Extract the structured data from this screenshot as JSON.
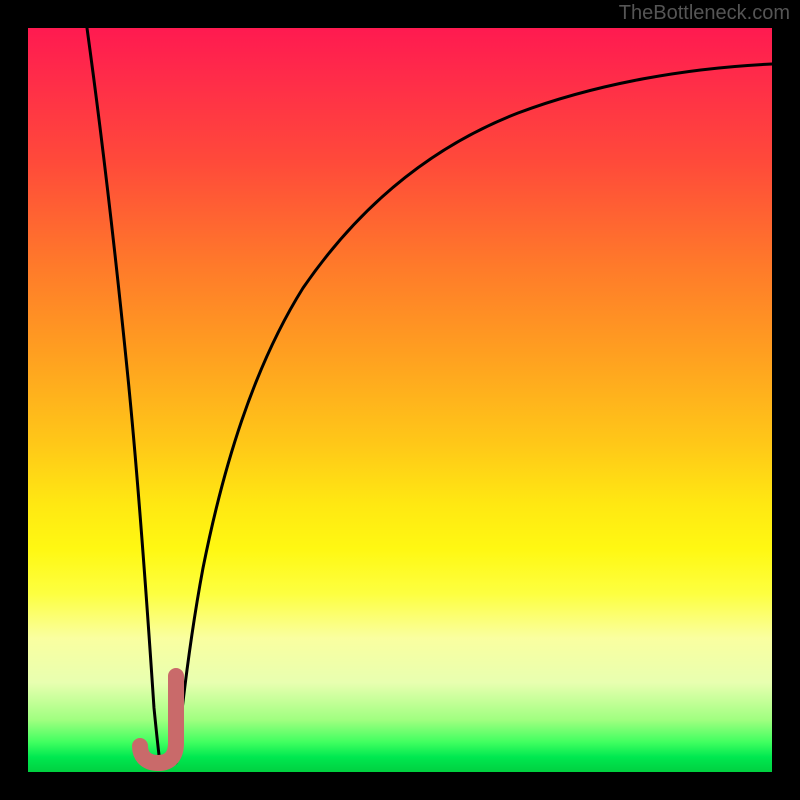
{
  "watermark": "TheBottleneck.com",
  "chart_data": {
    "type": "line",
    "title": "",
    "xlabel": "",
    "ylabel": "",
    "xlim": [
      0,
      100
    ],
    "ylim": [
      0,
      100
    ],
    "series": [
      {
        "name": "left-curve",
        "x": [
          8,
          10,
          12,
          14,
          16,
          17
        ],
        "y": [
          100,
          78,
          55,
          30,
          10,
          2
        ]
      },
      {
        "name": "right-curve",
        "x": [
          19,
          21,
          23,
          26,
          30,
          35,
          42,
          50,
          60,
          72,
          85,
          100
        ],
        "y": [
          2,
          15,
          30,
          45,
          58,
          68,
          76,
          82,
          86,
          89,
          91,
          92
        ]
      }
    ],
    "marker": {
      "name": "j-marker",
      "color": "#cc6666",
      "x_range": [
        14.5,
        20.5
      ],
      "y_range": [
        2,
        12
      ]
    },
    "gradient_stops": [
      {
        "pos": 0,
        "color": "#ff1a50"
      },
      {
        "pos": 0.5,
        "color": "#ffd018"
      },
      {
        "pos": 0.78,
        "color": "#fcff60"
      },
      {
        "pos": 1.0,
        "color": "#00d040"
      }
    ]
  }
}
